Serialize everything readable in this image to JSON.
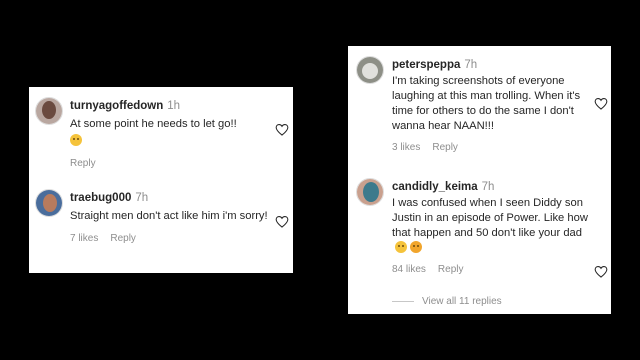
{
  "left_card": {
    "comments": [
      {
        "username": "turnyagoffedown",
        "time": "1h",
        "text": "At some point he needs to let go!!",
        "emoji": "grimacing-emoji",
        "actions": {
          "likes": "",
          "reply": "Reply"
        }
      },
      {
        "username": "traebug000",
        "time": "7h",
        "text": "Straight men don't act like him i'm sorry!",
        "actions": {
          "likes": "7 likes",
          "reply": "Reply"
        }
      }
    ]
  },
  "right_card": {
    "comments": [
      {
        "username": "peterspeppa",
        "time": "7h",
        "text": "I'm taking screenshots of everyone laughing at this man trolling. When it's time for others to do the same I don't wanna hear NAAN!!!",
        "actions": {
          "likes": "3 likes",
          "reply": "Reply"
        }
      },
      {
        "username": "candidly_keima",
        "time": "7h",
        "text": "I was confused when I seen Diddy son Justin in an episode of Power. Like how that happen and 50 don't like your dad",
        "emojis": [
          "thinking-emoji",
          "pleading-emoji"
        ],
        "actions": {
          "likes": "84 likes",
          "reply": "Reply"
        }
      }
    ],
    "view_replies": "View all 11 replies"
  },
  "colors": {
    "background": "#000000",
    "card": "#ffffff",
    "username": "#262626",
    "muted": "#8e8e8e"
  }
}
